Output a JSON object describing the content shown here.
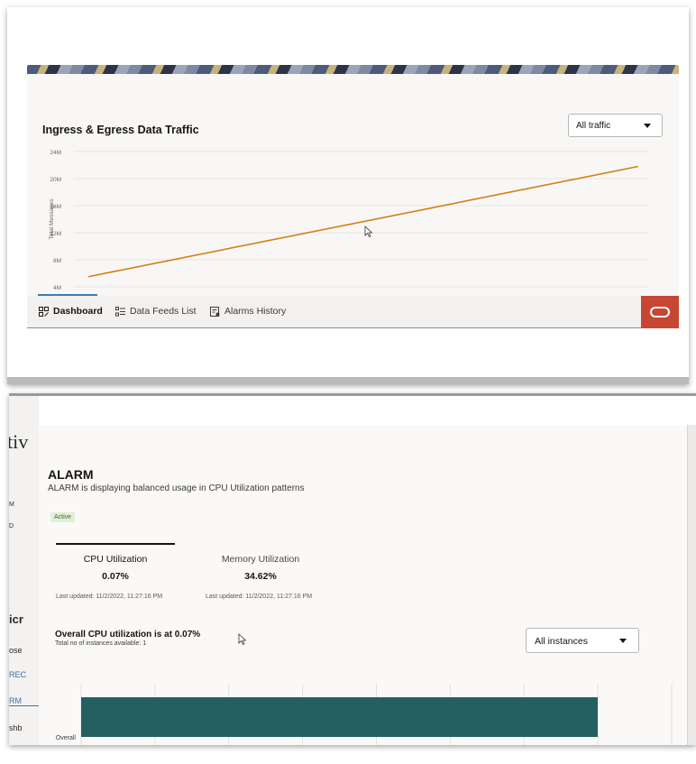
{
  "traffic": {
    "title": "Ingress & Egress Data Traffic",
    "filter_value": "All traffic",
    "tabs": [
      {
        "label": "Dashboard"
      },
      {
        "label": "Data Feeds List"
      },
      {
        "label": "Alarms History"
      }
    ]
  },
  "chart_data": [
    {
      "type": "line",
      "title": "Ingress & Egress Data Traffic",
      "xlabel": "",
      "ylabel": "Total Messages",
      "ylim": [
        4,
        24
      ],
      "ytick_labels": [
        "24M",
        "20M",
        "16M",
        "12M",
        "8M",
        "4M"
      ],
      "ytick_values": [
        24,
        20,
        16,
        12,
        8,
        4
      ],
      "x": [
        0,
        1
      ],
      "series": [
        {
          "values": [
            5.5,
            21.8
          ],
          "color": "#d57f14"
        }
      ],
      "grid": true
    },
    {
      "type": "bar",
      "orientation": "horizontal",
      "categories": [
        "Overall"
      ],
      "values": [
        0.07
      ],
      "color": "#245f62",
      "grid": true
    }
  ],
  "drawer": {
    "prev_label": "‹",
    "next_label": "›",
    "close_label": "×",
    "title": "ALARM",
    "description": "ALARM is displaying balanced usage in CPU Utilization patterns",
    "status": "Active",
    "metrics": [
      {
        "label": "CPU Utilization",
        "value": "0.07%",
        "updated": "Last updated: 11/2/2022, 11:27:16 PM"
      },
      {
        "label": "Memory Utilization",
        "value": "34.62%",
        "updated": "Last updated: 11/2/2022, 11:27:16 PM"
      }
    ],
    "overall_title": "Overall CPU utilization is at 0.07%",
    "overall_sub": "Total no of instances available: 1",
    "instances_value": "All instances"
  },
  "background_fragments": [
    "tiv",
    "M",
    "D",
    "icr",
    "ose",
    "REC",
    "RM",
    "shb"
  ],
  "colors": {
    "accent": "#3d7fa8",
    "line": "#d57f14",
    "bar": "#245f62",
    "brand": "#c74634",
    "badge_bg": "#e1efd8"
  }
}
